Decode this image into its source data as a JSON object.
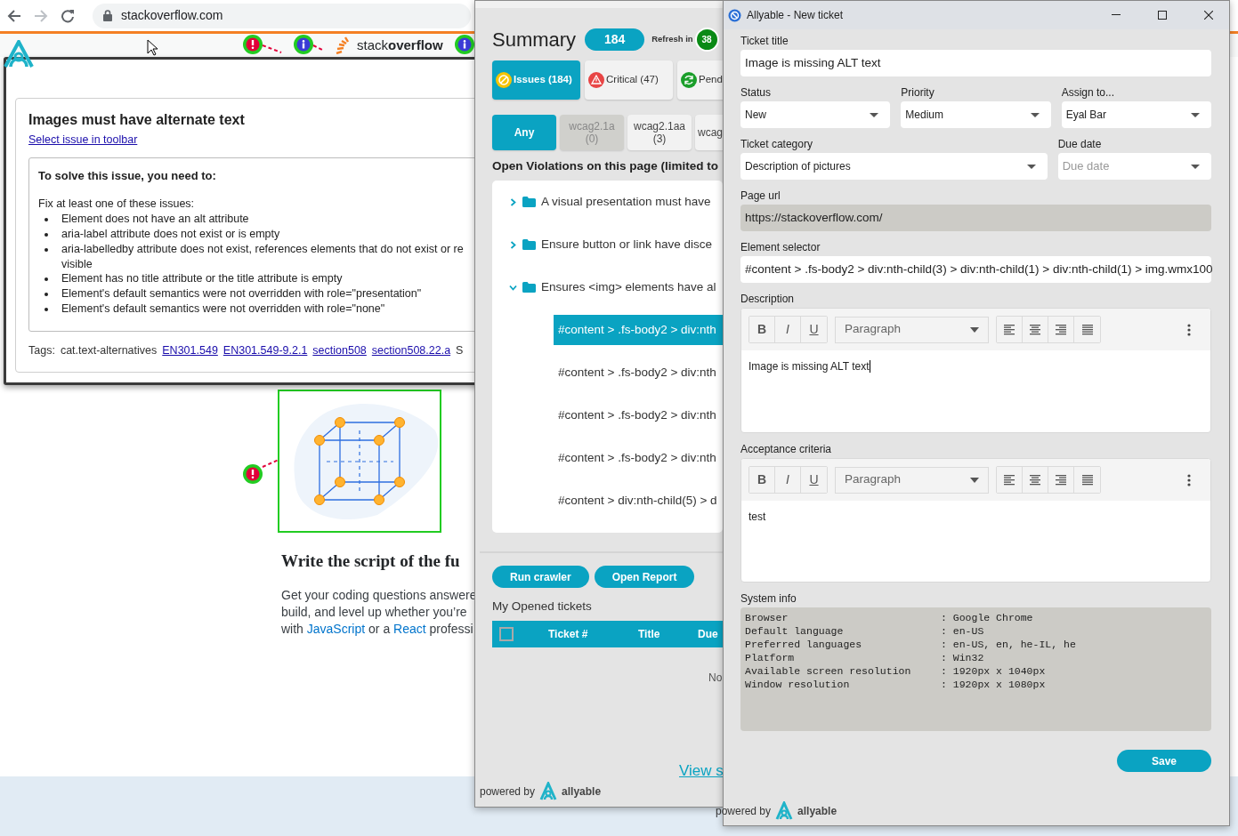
{
  "browser": {
    "url": "stackoverflow.com",
    "back_enabled": true,
    "forward_enabled": false
  },
  "page": {
    "logo": "stack**overflow**",
    "markers": [
      {
        "kind": "error"
      },
      {
        "kind": "info"
      },
      {
        "kind": "info"
      },
      {
        "kind": "error"
      }
    ],
    "heading": "Write the script of the fu",
    "intro_lines": [
      [
        {
          "text": "Get your coding questions answere"
        }
      ],
      [
        {
          "text": "build, and level up whether you’re"
        }
      ],
      [
        {
          "text": "with "
        },
        {
          "text": "JavaScript",
          "link": true
        },
        {
          "text": " or a "
        },
        {
          "text": "React",
          "link": true
        },
        {
          "text": " professi"
        }
      ]
    ]
  },
  "issue_popup": {
    "title": "Images must have alternate text",
    "toolbar_link": "Select issue in toolbar",
    "fix_heading": "To solve this issue, you need to:",
    "fix_intro": "Fix at least one of these issues:",
    "fixes": [
      {
        "text": "Element does not have an alt attribute"
      },
      {
        "text": "aria-label attribute does not exist or is empty"
      },
      {
        "text": "aria-labelledby attribute does not exist, references elements that do not exist or re",
        "continued": "visible"
      },
      {
        "text": "Element has no title attribute or the title attribute is empty"
      },
      {
        "text": "Element's default semantics were not overridden with role=\"presentation\""
      },
      {
        "text": "Element's default semantics were not overridden with role=\"none\""
      }
    ],
    "tags_label": "Tags:",
    "tags": [
      {
        "text": "cat.text-alternatives",
        "link": false
      },
      {
        "text": "EN301.549",
        "link": true
      },
      {
        "text": "EN301.549-9.2.1",
        "link": true
      },
      {
        "text": "section508",
        "link": true
      },
      {
        "text": "section508.22.a",
        "link": true
      },
      {
        "text": "S",
        "link": false
      }
    ]
  },
  "summary_panel": {
    "title": "Summary",
    "total": "184",
    "refresh_label": "Refresh in",
    "refresh_seconds": "38",
    "tabs": [
      {
        "label": "Issues (184)",
        "kind": "issues",
        "selected": true
      },
      {
        "label": "Critical (47)",
        "kind": "critical",
        "selected": false
      },
      {
        "label": "Pend",
        "kind": "pending",
        "selected": false
      }
    ],
    "filters": [
      {
        "label": "Any",
        "selected": true,
        "disabled": false
      },
      {
        "label": "wcag2.1a",
        "count": "(0)",
        "selected": false,
        "disabled": true
      },
      {
        "label": "wcag2.1aa",
        "count": "(3)",
        "selected": false,
        "disabled": false
      },
      {
        "label": "wcag",
        "selected": false,
        "disabled": false
      }
    ],
    "violations_heading": "Open Violations on this page (limited to",
    "violations": [
      {
        "label": "A visual presentation must have",
        "expanded": false
      },
      {
        "label": "Ensure button or link have disce",
        "expanded": false
      },
      {
        "label": "Ensures <img> elements have al",
        "expanded": true,
        "children": [
          {
            "label": "#content > .fs-body2 > div:nth",
            "selected": true
          },
          {
            "label": "#content > .fs-body2 > div:nth",
            "selected": false
          },
          {
            "label": "#content > .fs-body2 > div:nth",
            "selected": false
          },
          {
            "label": "#content > .fs-body2 > div:nth",
            "selected": false
          },
          {
            "label": "#content > div:nth-child(5) > d",
            "selected": false
          }
        ]
      }
    ],
    "actions": [
      "Run crawler",
      "Open Report"
    ],
    "tickets_heading": "My Opened tickets",
    "ticket_columns": [
      "Ticket #",
      "Title",
      "Due"
    ],
    "select_all_checked": false,
    "empty_message": "No",
    "view_link": "View s",
    "powered_by": "powered by",
    "brand": "allyable"
  },
  "ticket_window": {
    "title": "Allyable - New ticket",
    "ticket_title": {
      "label": "Ticket title",
      "value": "Image is missing ALT text"
    },
    "status": {
      "label": "Status",
      "value": "New"
    },
    "priority": {
      "label": "Priority",
      "value": "Medium"
    },
    "assignee": {
      "label": "Assign to...",
      "value": "Eyal Bar"
    },
    "category": {
      "label": "Ticket category",
      "value": "Description of pictures"
    },
    "due_date": {
      "label": "Due date",
      "placeholder": "Due date"
    },
    "page_url": {
      "label": "Page url",
      "value": "https://stackoverflow.com/",
      "disabled": true
    },
    "element_selector": {
      "label": "Element selector",
      "value": "#content > .fs-body2 > div:nth-child(3) > div:nth-child(1) > div:nth-child(1) > img.wmx100"
    },
    "editors": [
      {
        "label": "Description",
        "format": "Paragraph",
        "styles": [
          "B",
          "I",
          "U"
        ],
        "text": "Image is missing ALT text",
        "focused": true
      },
      {
        "label": "Acceptance criteria",
        "format": "Paragraph",
        "styles": [
          "B",
          "I",
          "U"
        ],
        "text": "test",
        "focused": false
      }
    ],
    "system_info": {
      "label": "System info",
      "rows": [
        {
          "key": "Browser",
          "value": ": Google Chrome"
        },
        {
          "key": "Default language",
          "value": ": en-US"
        },
        {
          "key": "Preferred languages",
          "value": ": en-US, en, he-IL, he"
        },
        {
          "key": "Platform",
          "value": ": Win32"
        },
        {
          "key": "Available screen resolution",
          "value": ": 1920px x 1040px"
        },
        {
          "key": "Window resolution",
          "value": ": 1920px x 1080px"
        }
      ]
    },
    "save": "Save",
    "powered_by": "powered by",
    "brand": "allyable"
  }
}
